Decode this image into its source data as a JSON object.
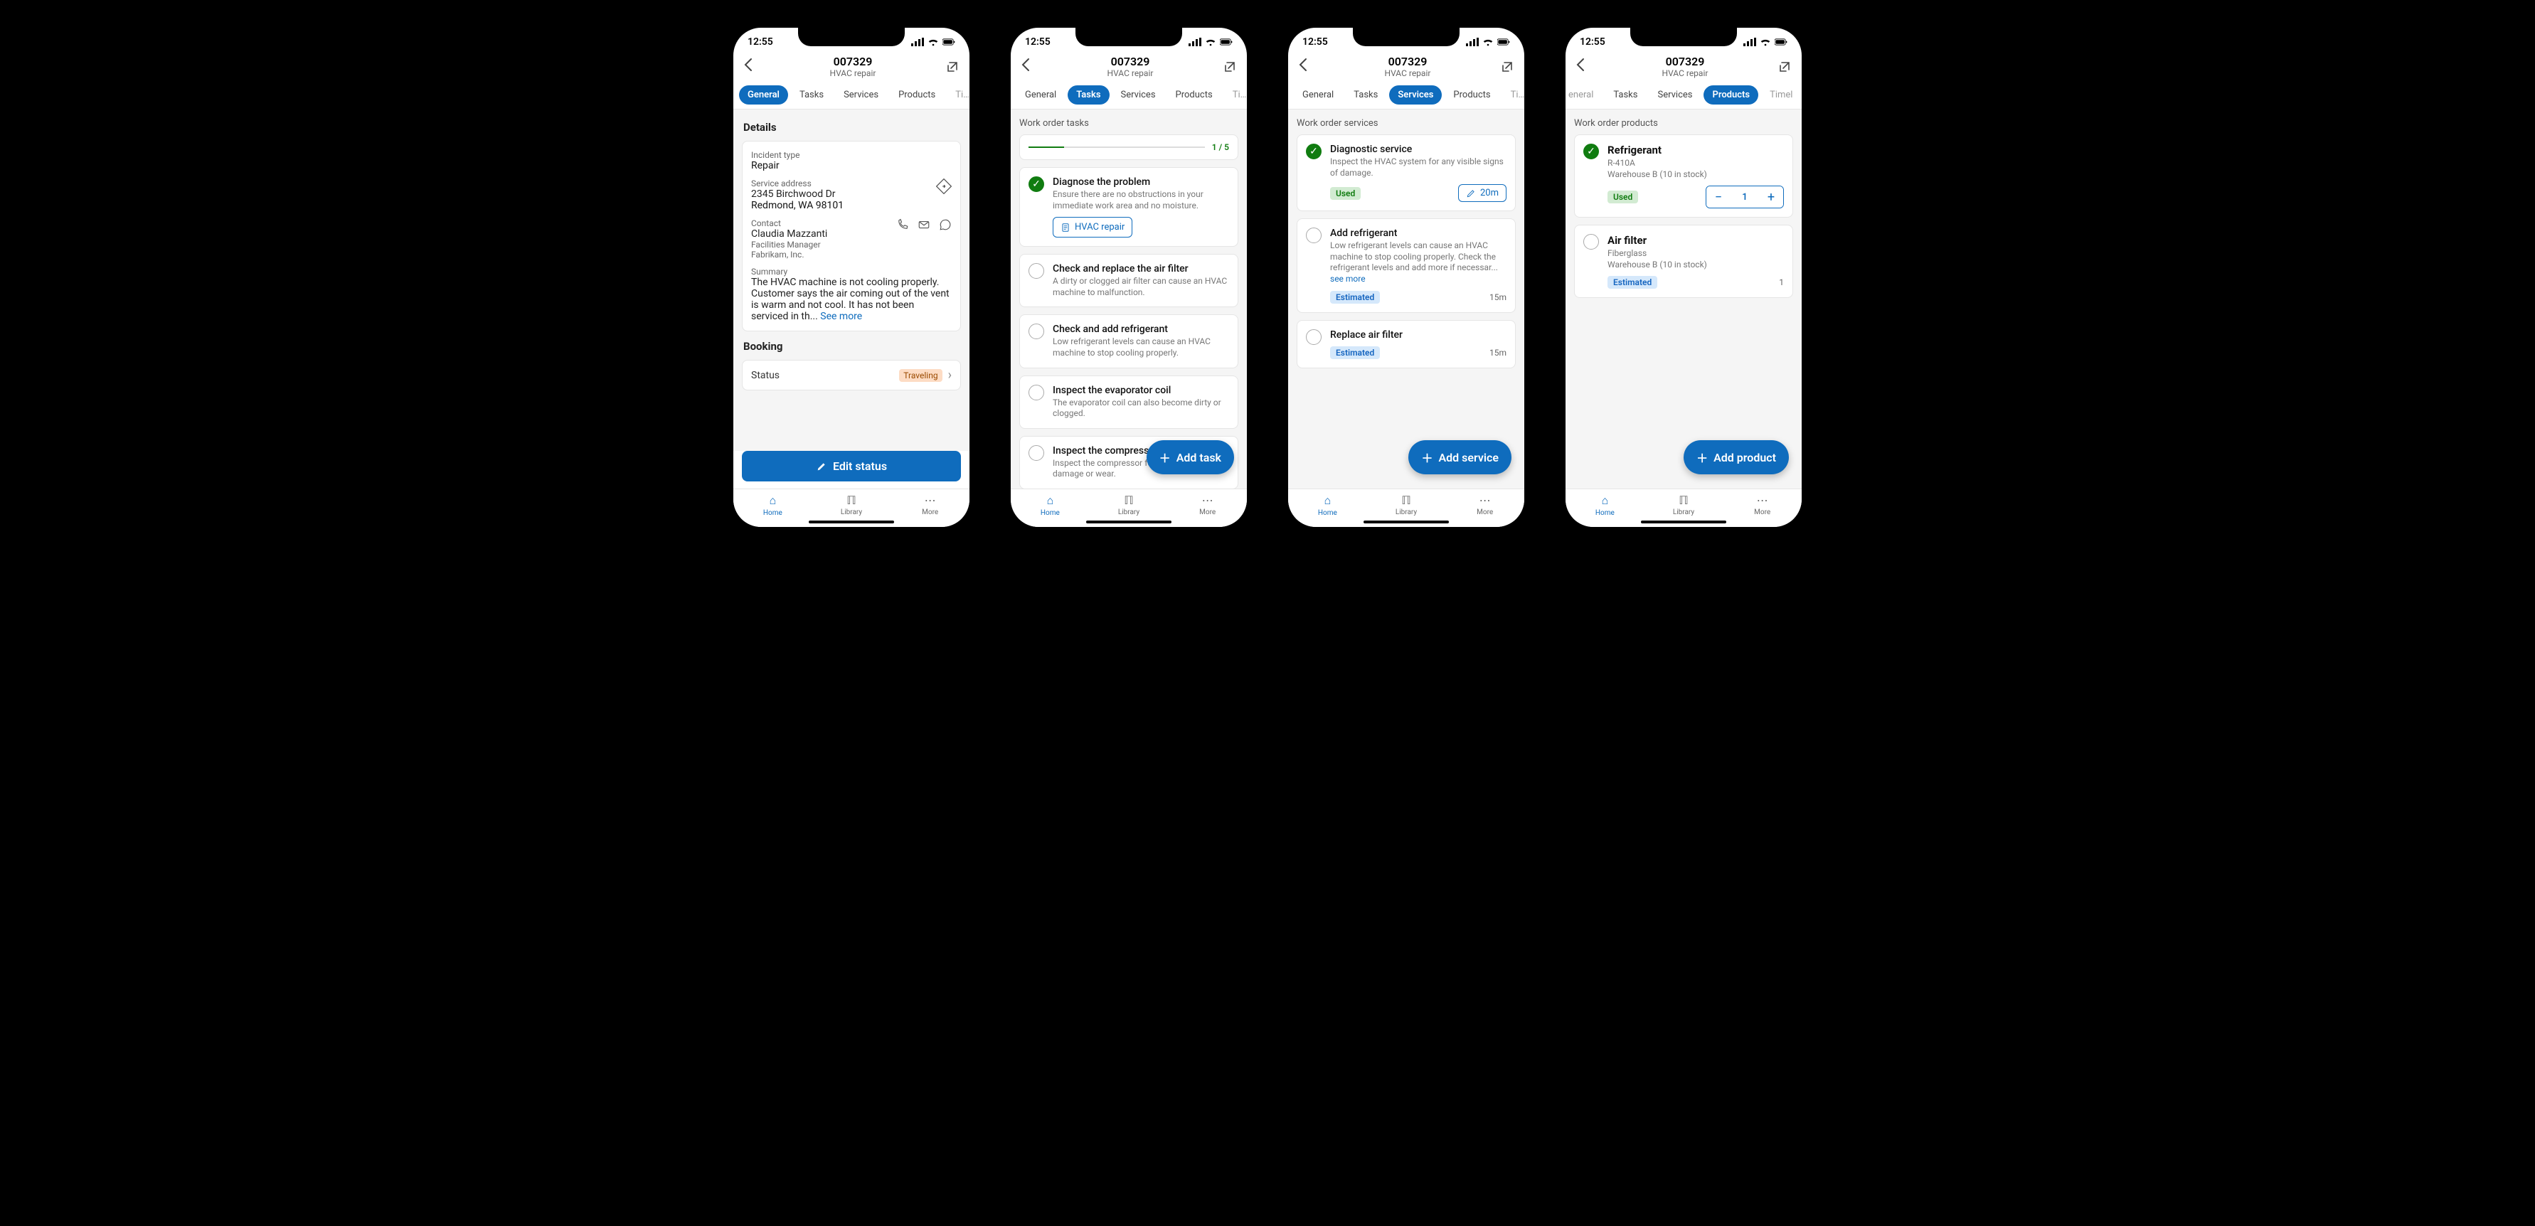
{
  "status_time": "12:55",
  "header": {
    "id": "007329",
    "sub": "HVAC repair"
  },
  "tabs": [
    "General",
    "Tasks",
    "Services",
    "Products",
    "Timeline"
  ],
  "nav": {
    "home": "Home",
    "library": "Library",
    "more": "More"
  },
  "phone1": {
    "details_heading": "Details",
    "incident_lbl": "Incident type",
    "incident_val": "Repair",
    "addr_lbl": "Service address",
    "addr_line1": "2345 Birchwood Dr",
    "addr_line2": "Redmond, WA 98101",
    "contact_lbl": "Contact",
    "contact_name": "Claudia Mazzanti",
    "contact_title": "Facilities Manager",
    "contact_company": "Fabrikam, Inc.",
    "summary_lbl": "Summary",
    "summary_text": "The HVAC machine is not cooling properly. Customer says the air coming out of the vent is warm and not cool. It has not been serviced in th... ",
    "see_more": "See more",
    "booking_heading": "Booking",
    "status_lbl": "Status",
    "status_val": "Traveling",
    "edit_btn": "Edit status"
  },
  "phone2": {
    "section": "Work order tasks",
    "progress": "1 / 5",
    "progress_pct": 20,
    "tasks": [
      {
        "done": true,
        "t": "Diagnose the problem",
        "s": "Ensure there are no obstructions in your immediate work area and no moisture.",
        "link": "HVAC repair"
      },
      {
        "done": false,
        "t": "Check and replace the air filter",
        "s": "A dirty or clogged air filter can cause an HVAC machine to malfunction."
      },
      {
        "done": false,
        "t": "Check and add refrigerant",
        "s": "Low refrigerant levels can cause an HVAC machine to stop cooling properly."
      },
      {
        "done": false,
        "t": "Inspect the evaporator coil",
        "s": "The evaporator coil can also become dirty or clogged."
      },
      {
        "done": false,
        "t": "Inspect the compressor",
        "s": "Inspect the compressor for any signs of damage or wear."
      }
    ],
    "fab": "Add task"
  },
  "phone3": {
    "section": "Work order services",
    "services": [
      {
        "done": true,
        "t": "Diagnostic service",
        "s": "Inspect the HVAC system for any visible signs of damage.",
        "badge": "Used",
        "dur": "20m",
        "dur_btn": true
      },
      {
        "done": false,
        "t": "Add refrigerant",
        "s": "Low refrigerant levels can cause an HVAC machine to stop cooling properly. Check the refrigerant levels and add more if necessar... ",
        "see_more": "see more",
        "badge": "Estimated",
        "dur": "15m"
      },
      {
        "done": false,
        "t": "Replace air filter",
        "badge": "Estimated",
        "dur": "15m"
      }
    ],
    "fab": "Add service"
  },
  "phone4": {
    "section": "Work order products",
    "products": [
      {
        "done": true,
        "t": "Refrigerant",
        "s1": "R-410A",
        "s2": "Warehouse B (10 in stock)",
        "badge": "Used",
        "qty": 1
      },
      {
        "done": false,
        "t": "Air filter",
        "s1": "Fiberglass",
        "s2": "Warehouse B (10 in stock)",
        "badge": "Estimated",
        "count": "1"
      }
    ],
    "fab": "Add product"
  }
}
